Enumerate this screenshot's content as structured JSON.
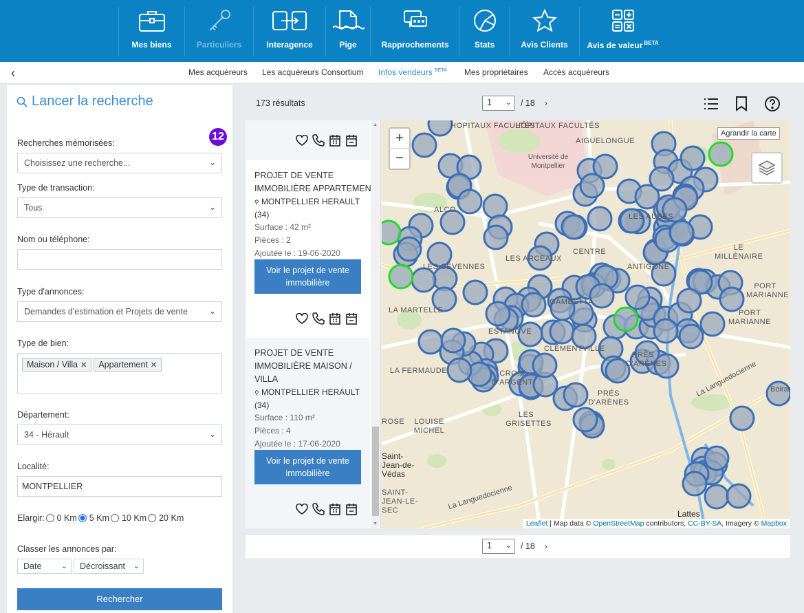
{
  "nav": {
    "items": [
      {
        "label": "Mes biens",
        "icon": "briefcase-icon"
      },
      {
        "label": "Particuliers",
        "icon": "key-icon",
        "disabled": true
      },
      {
        "label": "Interagence",
        "icon": "exchange-icon"
      },
      {
        "label": "Pige",
        "icon": "document-wave-icon"
      },
      {
        "label": "Rapprochements",
        "icon": "chat-icon"
      },
      {
        "label": "Stats",
        "icon": "pie-chart-icon"
      },
      {
        "label": "Avis Clients",
        "icon": "star-icon"
      },
      {
        "label": "Avis de valeur",
        "badge": "BETA",
        "icon": "calculator-icon"
      }
    ]
  },
  "subnav": {
    "back": "‹",
    "tabs": [
      {
        "label": "Mes acquéreurs"
      },
      {
        "label": "Les acquéreurs Consortium"
      },
      {
        "label": "Infos vendeurs",
        "badge": "BETA",
        "active": true
      },
      {
        "label": "Mes propriétaires"
      },
      {
        "label": "Accès acquéreurs"
      }
    ]
  },
  "search": {
    "title": "Lancer la recherche",
    "badge": "12",
    "saved_label": "Recherches mémorisées:",
    "saved_value": "Choisissez une recherche...",
    "transaction_label": "Type de transaction:",
    "transaction_value": "Tous",
    "name_label": "Nom ou téléphone:",
    "name_value": "",
    "ads_label": "Type d'annonces:",
    "ads_value": "Demandes d'estimation et Projets de vente",
    "property_label": "Type de bien:",
    "property_tags": [
      "Maison / Villa",
      "Appartement"
    ],
    "dept_label": "Département:",
    "dept_value": "34 - Hérault",
    "locality_label": "Localité:",
    "locality_value": "MONTPELLIER",
    "widen_label": "Elargir:",
    "widen_options": [
      "0 Km",
      "5 Km",
      "10 Km",
      "20 Km"
    ],
    "widen_selected": "5 Km",
    "sort_label": "Classer les annonces par:",
    "sort_field": "Date",
    "sort_order": "Décroissant",
    "submit": "Rechercher"
  },
  "results": {
    "count": "173 résultats",
    "page": "1",
    "total_pages": "/ 18",
    "next": "›"
  },
  "listings": [
    {
      "title_line1": "PROJET DE VENTE",
      "title_line2": "IMMOBILIÈRE APPARTEMENT",
      "location": "MONTPELLIER HERAULT",
      "dept": "(34)",
      "surface": "Surface : 42 m²",
      "rooms": "Pièces : 2",
      "added": "Ajoutée le : 19-06-2020",
      "cta_line1": "Voir le projet de vente",
      "cta_line2": "immobilière"
    },
    {
      "title_line1": "PROJET DE VENTE",
      "title_line2": "IMMOBILIÈRE MAISON /",
      "title_line3": "VILLA",
      "location": "MONTPELLIER HERAULT",
      "dept": "(34)",
      "surface": "Surface : 110 m²",
      "rooms": "Pièces : 4",
      "added": "Ajoutée le : 17-06-2020",
      "cta_line1": "Voir le projet de vente",
      "cta_line2": "immobilière"
    }
  ],
  "map": {
    "zoom_in": "+",
    "zoom_out": "−",
    "enlarge_tooltip": "Agrandir la carte",
    "labels": [
      "HOPITAUX FACULTÉS",
      "HÔPITAUX FACULTÉS",
      "AIGUELONGUE",
      "Université de Montpellier",
      "ALCO",
      "LES AUBES",
      "CENTRE",
      "LES ARCEAUX",
      "LES CÉVENNES",
      "ANTIGONE",
      "LE MILLÉNAIRE",
      "GAMBETTA",
      "LA MARTELLE",
      "PORT MARIANNE",
      "PORT MARIANNE",
      "ESTANOVE",
      "CLÉMENTVILLE",
      "PRÈS D'ARÈNES",
      "LA FERMAUDE",
      "CROIX D'ARGENT",
      "PRÉS D'ARÈNES",
      "La Languedocienne",
      "Boirargues",
      "ROSE",
      "LOUISE MICHEL",
      "LES GRISETTES",
      "Saint-Jean-de-Védas",
      "SAINT-JEAN-LE-SEC",
      "La Languedocienne",
      "Lattes"
    ],
    "attribution": {
      "leaflet": "Leaflet",
      "mapdata": " | Map data © ",
      "osm": "OpenStreetMap",
      "contributors": " contributors, ",
      "license": "CC-BY-SA",
      "imagery": ", Imagery © ",
      "mapbox": "Mapbox"
    },
    "colors": {
      "marker": "#3b6fb6",
      "marker_fill": "#9aa9bd",
      "marker_new": "#22dd22"
    }
  }
}
